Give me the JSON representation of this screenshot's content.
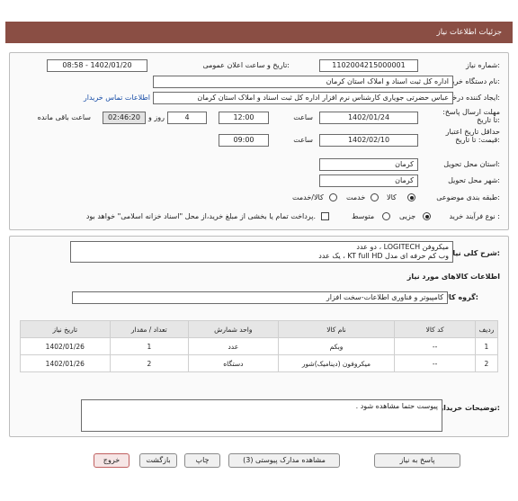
{
  "header": {
    "title": "جزئیات اطلاعات نیاز"
  },
  "form": {
    "need_number_label": "شماره نیاز:",
    "need_number": "1102004215000001",
    "announce_label": "تاریخ و ساعت اعلان عمومی:",
    "announce_value": "1402/01/20 - 08:58",
    "buyer_org_label": "نام دستگاه خریدار:",
    "buyer_org": "اداره کل ثبت اسناد و املاک استان کرمان",
    "creator_label": "ایجاد کننده درخواست:",
    "creator": "عباس حضرتی جویاری کارشناس نرم افزار اداره کل ثبت اسناد و املاک استان کرمان",
    "contact_link": "اطلاعات تماس خریدار",
    "deadline_label": "مهلت ارسال پاسخ: تا تاریخ:",
    "deadline_date": "1402/01/24",
    "time_label": "ساعت",
    "deadline_time": "12:00",
    "days_value": "4",
    "day_and_label": "روز و",
    "remaining_time": "02:46:20",
    "remaining_label": "ساعت باقی مانده",
    "validity_label": "حداقل تاریخ اعتبار قیمت: تا تاریخ:",
    "validity_date": "1402/02/10",
    "validity_time_label": "ساعت",
    "validity_time": "09:00",
    "province_label": "استان محل تحویل:",
    "province": "کرمان",
    "city_label": "شهر محل تحویل:",
    "city": "کرمان",
    "category_label": "طبقه بندی موضوعی:",
    "category_options": [
      "کالا",
      "خدمت",
      "کالا/خدمت"
    ],
    "process_label": "نوع فرآیند خرید :",
    "process_options": [
      "جزیی",
      "متوسط"
    ],
    "payment_note": "پرداخت تمام یا بخشی از مبلغ خرید،از محل \"اسناد خزانه اسلامی\" خواهد بود."
  },
  "description": {
    "label": "شرح کلی نیاز:",
    "line1": "میکروفن  LOGITECH  ،      دو عدد",
    "line2": "وب کم حرفه ای مدل KT full HD  ،  یک عدد"
  },
  "goods": {
    "section_title": "اطلاعات کالاهای مورد نیاز",
    "group_label": "گروه کالا:",
    "group_value": "کامپیوتر و فناوری اطلاعات-سخت افزار",
    "columns": [
      "ردیف",
      "کد کالا",
      "نام کالا",
      "واحد شمارش",
      "تعداد / مقدار",
      "تاریخ نیاز"
    ],
    "rows": [
      [
        "1",
        "--",
        "وبکم",
        "عدد",
        "1",
        "1402/01/26"
      ],
      [
        "2",
        "--",
        "میکروفون (دینامیک)شور",
        "دستگاه",
        "2",
        "1402/01/26"
      ]
    ]
  },
  "buyer_notes": {
    "label": "توضیحات خریدار:",
    "text": "پیوست حتما مشاهده شود ."
  },
  "buttons": {
    "reply": "پاسخ به نیاز",
    "docs": "مشاهده مدارک پیوستی (3)",
    "print": "چاپ",
    "back": "بازگشت",
    "exit": "خروج"
  }
}
